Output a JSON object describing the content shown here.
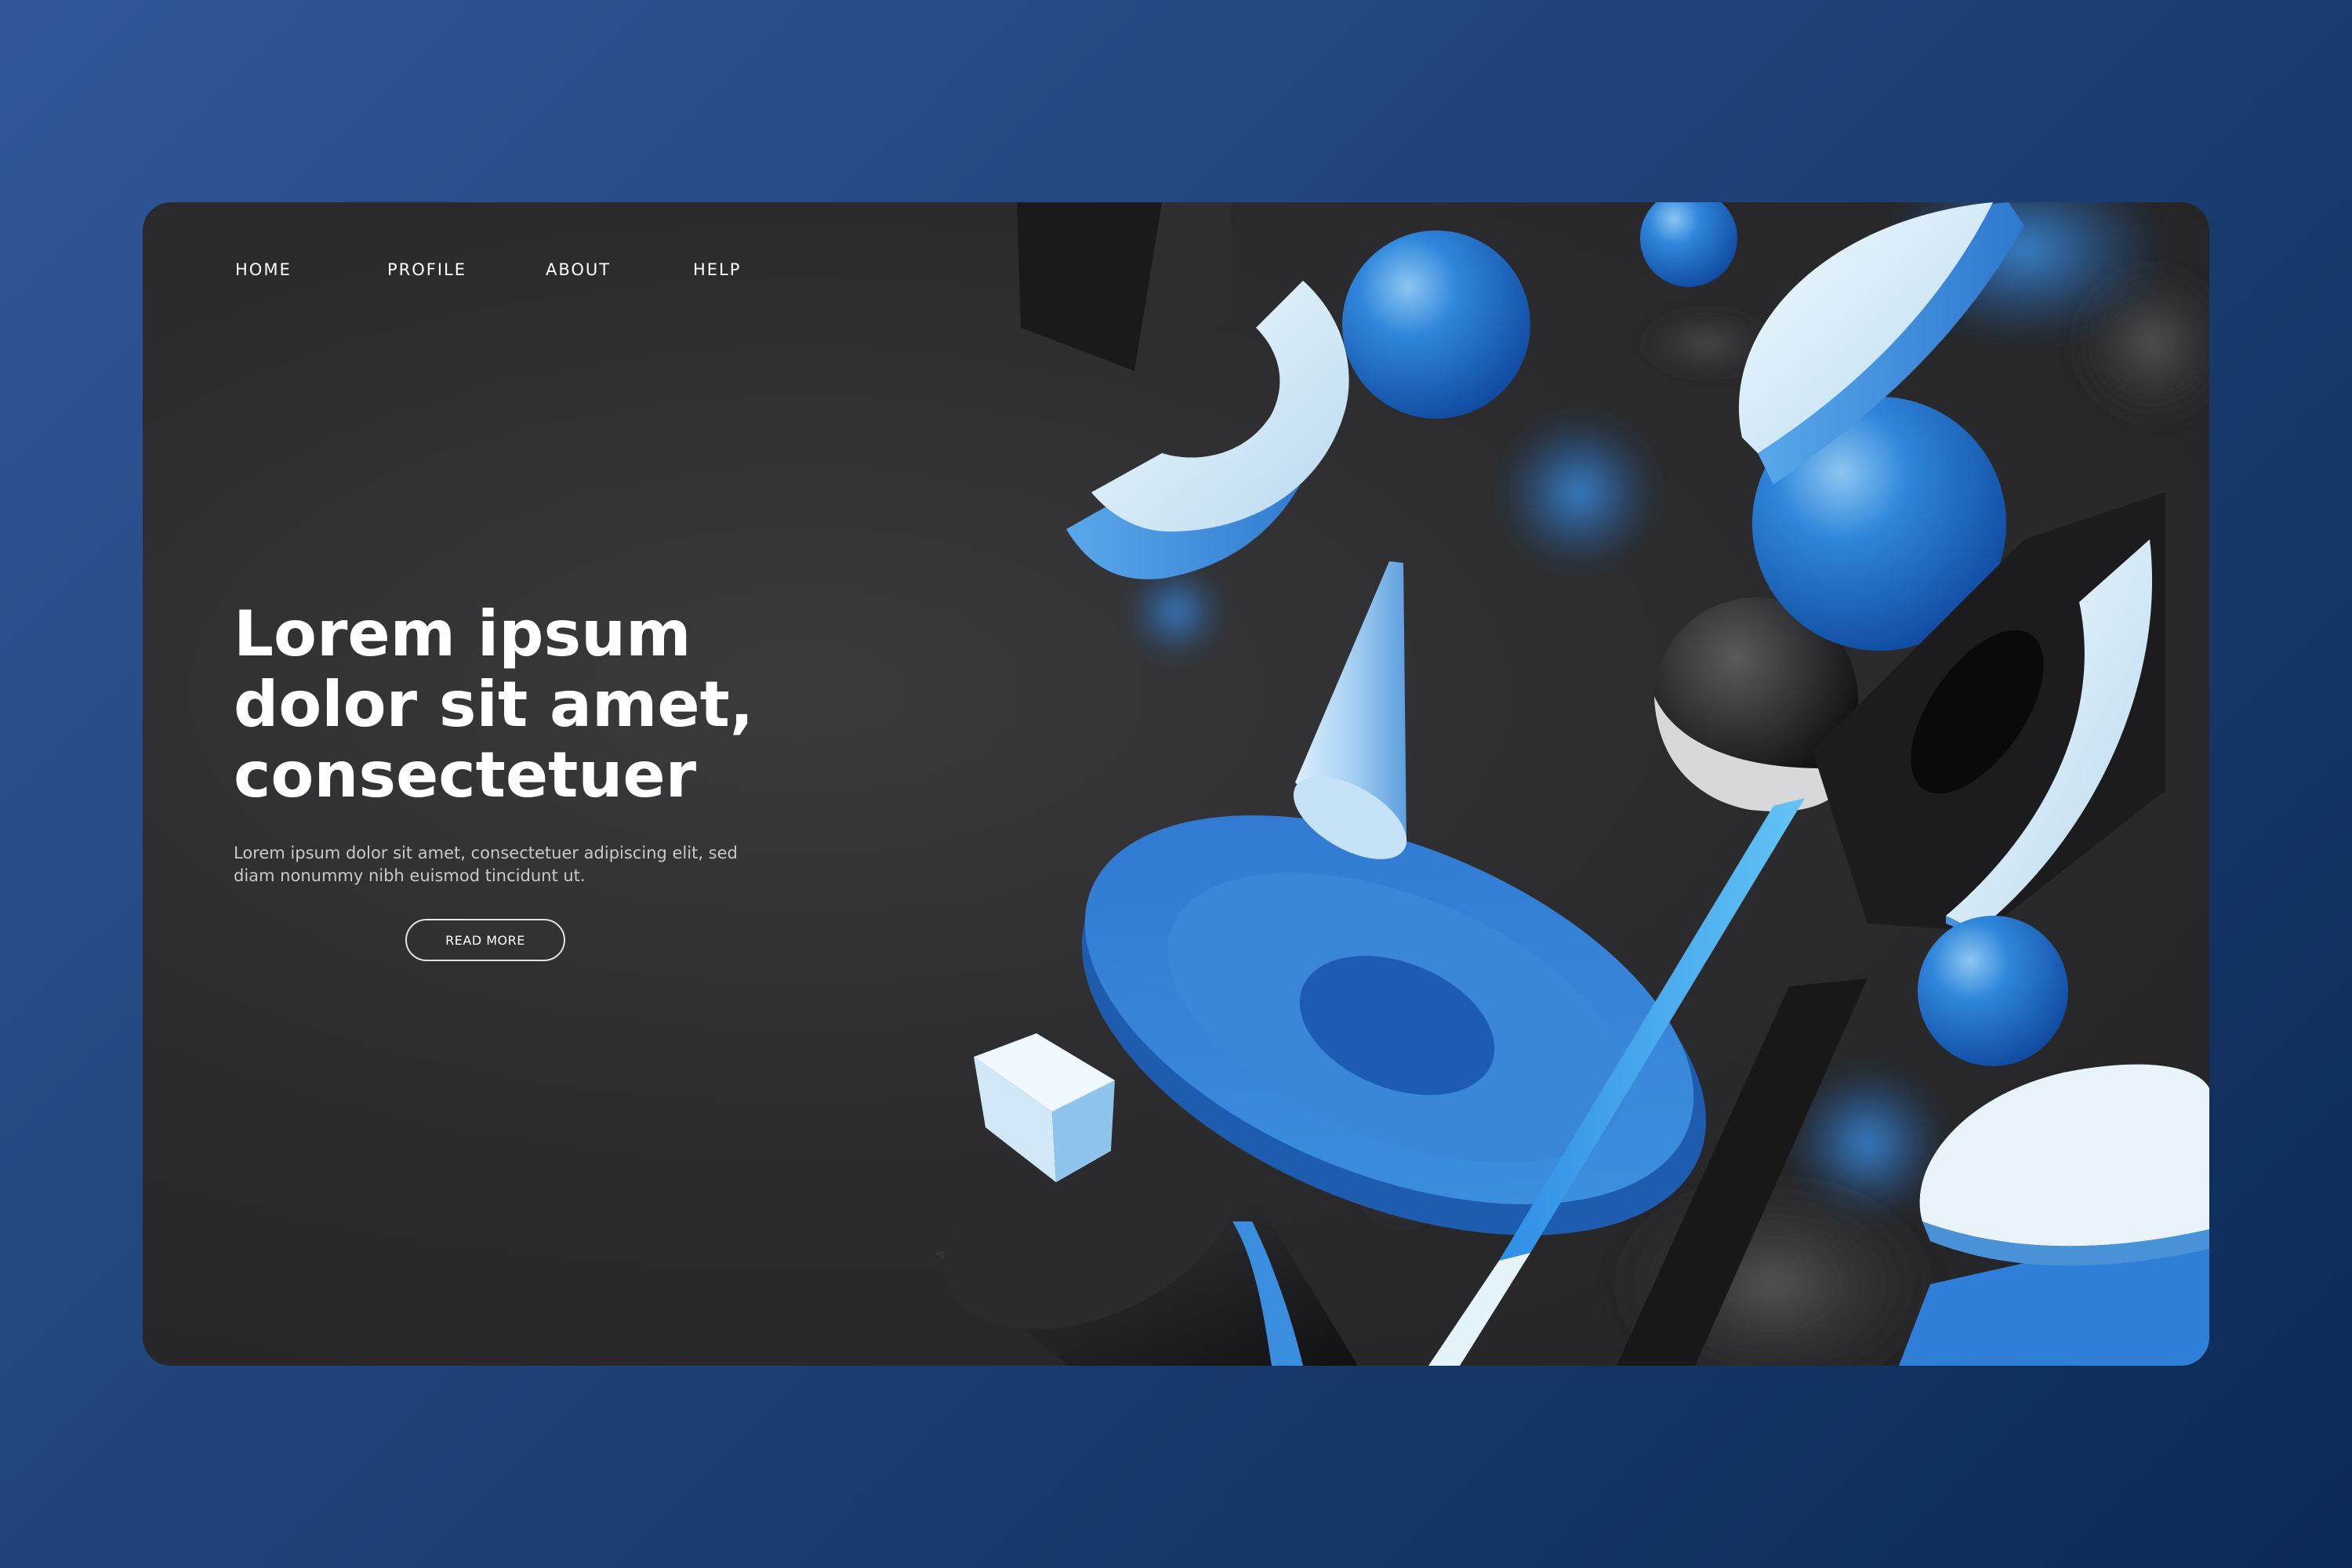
{
  "nav": {
    "items": [
      {
        "label": "HOME"
      },
      {
        "label": "PROFILE"
      },
      {
        "label": "ABOUT"
      },
      {
        "label": "HELP"
      }
    ]
  },
  "hero": {
    "title_lines": [
      "Lorem ipsum",
      "dolor sit amet,",
      "consectetuer"
    ],
    "description": "Lorem ipsum dolor sit amet, consectetuer adipiscing elit, sed diam nonummy nibh euismod tincidunt ut.",
    "button_label": "READ MORE"
  },
  "colors": {
    "page_background": "#2a4f8e",
    "card_background": "#2c2c2e",
    "accent_blue": "#2f7ed8",
    "light_blue": "#bfe0f5",
    "text_primary": "#ffffff",
    "text_secondary": "#c9c9cc"
  }
}
